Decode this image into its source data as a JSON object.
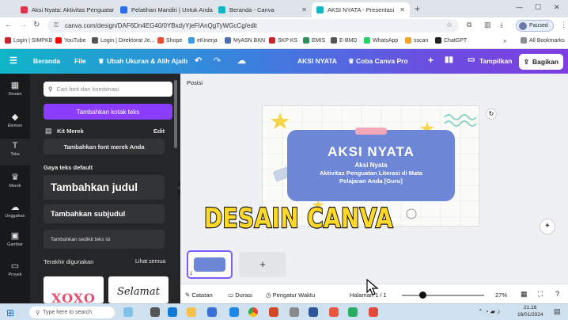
{
  "browser": {
    "tabs": [
      {
        "label": "Aksi Nyata: Aktivitas Penguatar",
        "color": "#e0334d"
      },
      {
        "label": "Pelatihan Mandiri | Untuk Anda",
        "color": "#2b6de8"
      },
      {
        "label": "Beranda - Canva",
        "color": "#14b6c6"
      },
      {
        "label": "AKSI NYATA - Presentasi",
        "color": "#14b6c6"
      }
    ],
    "new_tab": "+",
    "url": "canva.com/design/DAF6Dn4EG40/0YBxdyYjeFIAnQgTyWGcCg/edit",
    "paused_label": "Paused",
    "bookmarks": [
      {
        "label": "Login | SIMPKB",
        "color": "#c8262e"
      },
      {
        "label": "YouTube",
        "color": "#ff0000"
      },
      {
        "label": "Login | Direktorat Je...",
        "color": "#555555"
      },
      {
        "label": "Shope",
        "color": "#ee4d2d"
      },
      {
        "label": "eKinerja",
        "color": "#3b9be0"
      },
      {
        "label": "MyASN BKN",
        "color": "#4c6fb1"
      },
      {
        "label": "SKP KS",
        "color": "#c8262e"
      },
      {
        "label": "EMIS",
        "color": "#2d8f5a"
      },
      {
        "label": "E-BMD",
        "color": "#555555"
      },
      {
        "label": "WhatsApp",
        "color": "#25d366"
      },
      {
        "label": "sscan",
        "color": "#f2a32c"
      },
      {
        "label": "ChatGPT",
        "color": "#222222"
      }
    ],
    "all_bookmarks": "All Bookmarks"
  },
  "canva_header": {
    "home": "Beranda",
    "file": "File",
    "resize": "Ubah Ukuran & Alih Ajaib",
    "design_title": "AKSI NYATA",
    "try_pro": "Coba Canva Pro",
    "present": "Tampilkan",
    "share": "Bagikan"
  },
  "rail": [
    {
      "label": "Desain",
      "glyph": "▦"
    },
    {
      "label": "Elemen",
      "glyph": "◆"
    },
    {
      "label": "Teks",
      "glyph": "T"
    },
    {
      "label": "Merek",
      "glyph": "♛"
    },
    {
      "label": "Unggahan",
      "glyph": "☁"
    },
    {
      "label": "Gambar",
      "glyph": "▣"
    },
    {
      "label": "Proyek",
      "glyph": "▭"
    }
  ],
  "panel": {
    "search_placeholder": "Cari font dan kombinasi",
    "add_text_box": "Tambahkan kotak teks",
    "brand_kit": "Kit Merek",
    "edit": "Edit",
    "add_brand_font": "Tambahkan font merek Anda",
    "default_styles": "Gaya teks default",
    "heading": "Tambahkan judul",
    "subheading": "Tambahkan subjudul",
    "body": "Tambahkan sedikit teks isi",
    "recent": "Terakhir digunakan",
    "see_all": "Lihat semua",
    "sample1": "XOXO",
    "sample2": "Selamat"
  },
  "canvas": {
    "position": "Posisi",
    "slide_title": "AKSI NYATA",
    "slide_line1": "Aksi Nyata",
    "slide_line2": "Aktivitas Penguatan Literasi di Mata",
    "slide_line3": "Pelajaran Anda [Guru]",
    "caption": "DESAIN CANVA",
    "add_page": "+"
  },
  "footer": {
    "notes": "Catatan",
    "duration": "Durasi",
    "timer": "Pengatur Waktu",
    "page": "Halaman 1 / 1",
    "zoom": "27%",
    "zoom_fraction": 0.27
  },
  "taskbar": {
    "search_placeholder": "Type here to search",
    "time": "21.16",
    "date": "16/01/2024"
  }
}
